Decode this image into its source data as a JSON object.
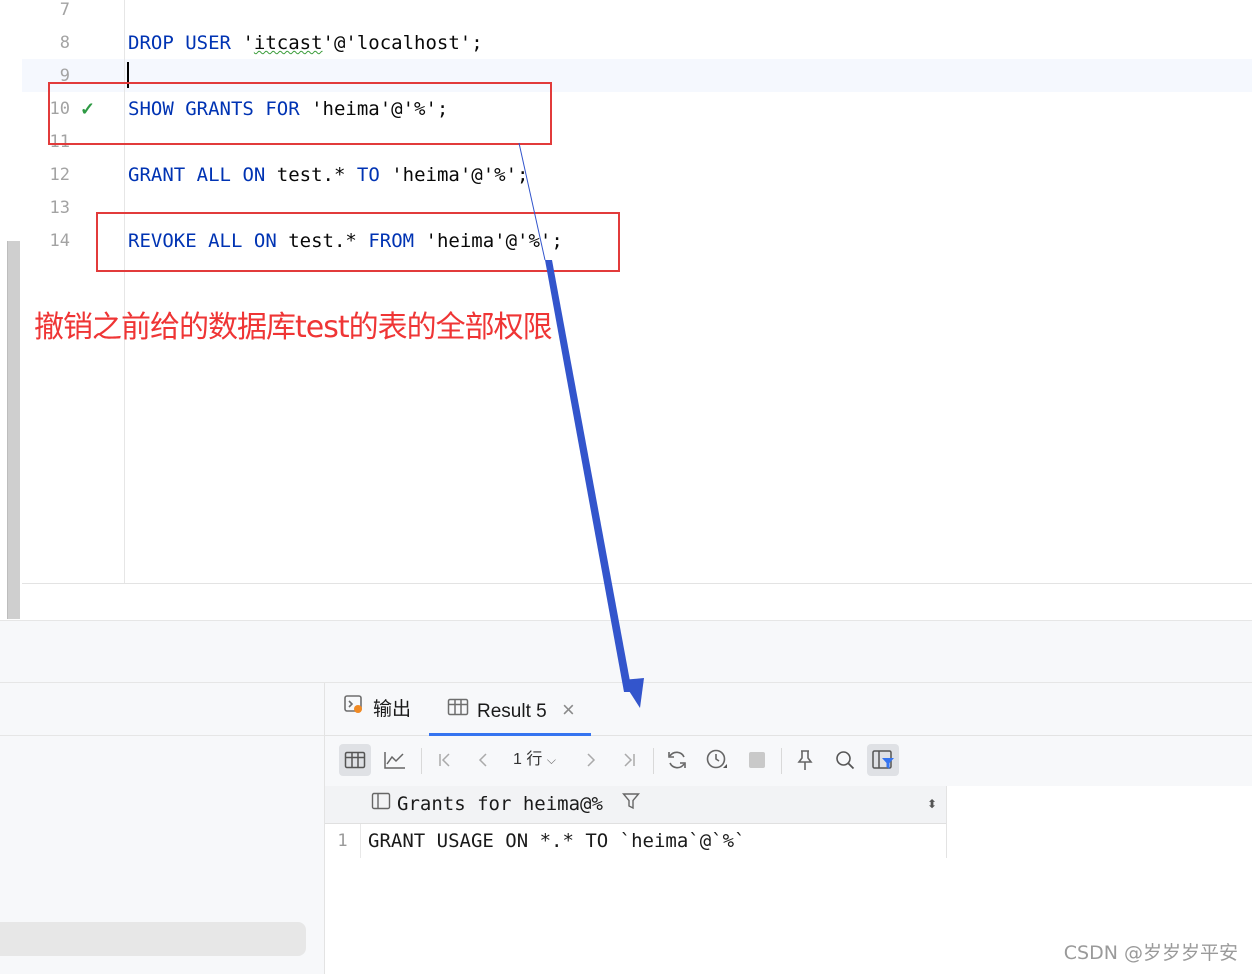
{
  "editor": {
    "lines": [
      {
        "num": "7",
        "code": ""
      },
      {
        "num": "8",
        "parts": [
          "DROP",
          "USER",
          "'itcast'@'localhost';"
        ]
      },
      {
        "num": "9",
        "code": ""
      },
      {
        "num": "10",
        "parts": [
          "SHOW",
          "GRANTS",
          "FOR",
          "'heima'@'%';"
        ]
      },
      {
        "num": "11",
        "code": ""
      },
      {
        "num": "12",
        "parts": [
          "GRANT",
          "ALL",
          "ON",
          "test.*",
          "TO",
          "'heima'@'%';"
        ]
      },
      {
        "num": "13",
        "code": ""
      },
      {
        "num": "14",
        "parts": [
          "REVOKE",
          "ALL",
          "ON",
          "test.*",
          "FROM",
          "'heima'@'%';"
        ]
      }
    ],
    "d8a": "'",
    "d8b": "itcast",
    "d8c": "'@'localhost';"
  },
  "annotation": {
    "note": "撤销之前给的数据库test的表的全部权限",
    "box_color": "#e23b3b",
    "arrow_color": "#3355cc"
  },
  "results_panel": {
    "tabs": [
      {
        "label": "输出",
        "icon": "output-icon"
      },
      {
        "label": "Result 5",
        "icon": "table-icon",
        "close": "×"
      }
    ],
    "row_selector": "1 行",
    "column_header": "Grants for heima@%",
    "rows": [
      {
        "num": "1",
        "value": "GRANT USAGE ON *.* TO `heima`@`%`"
      }
    ]
  },
  "watermark": "CSDN @岁岁岁平安",
  "colors": {
    "keyword": "#0033b3",
    "accent": "#3574f0",
    "check": "#2e9a44"
  }
}
